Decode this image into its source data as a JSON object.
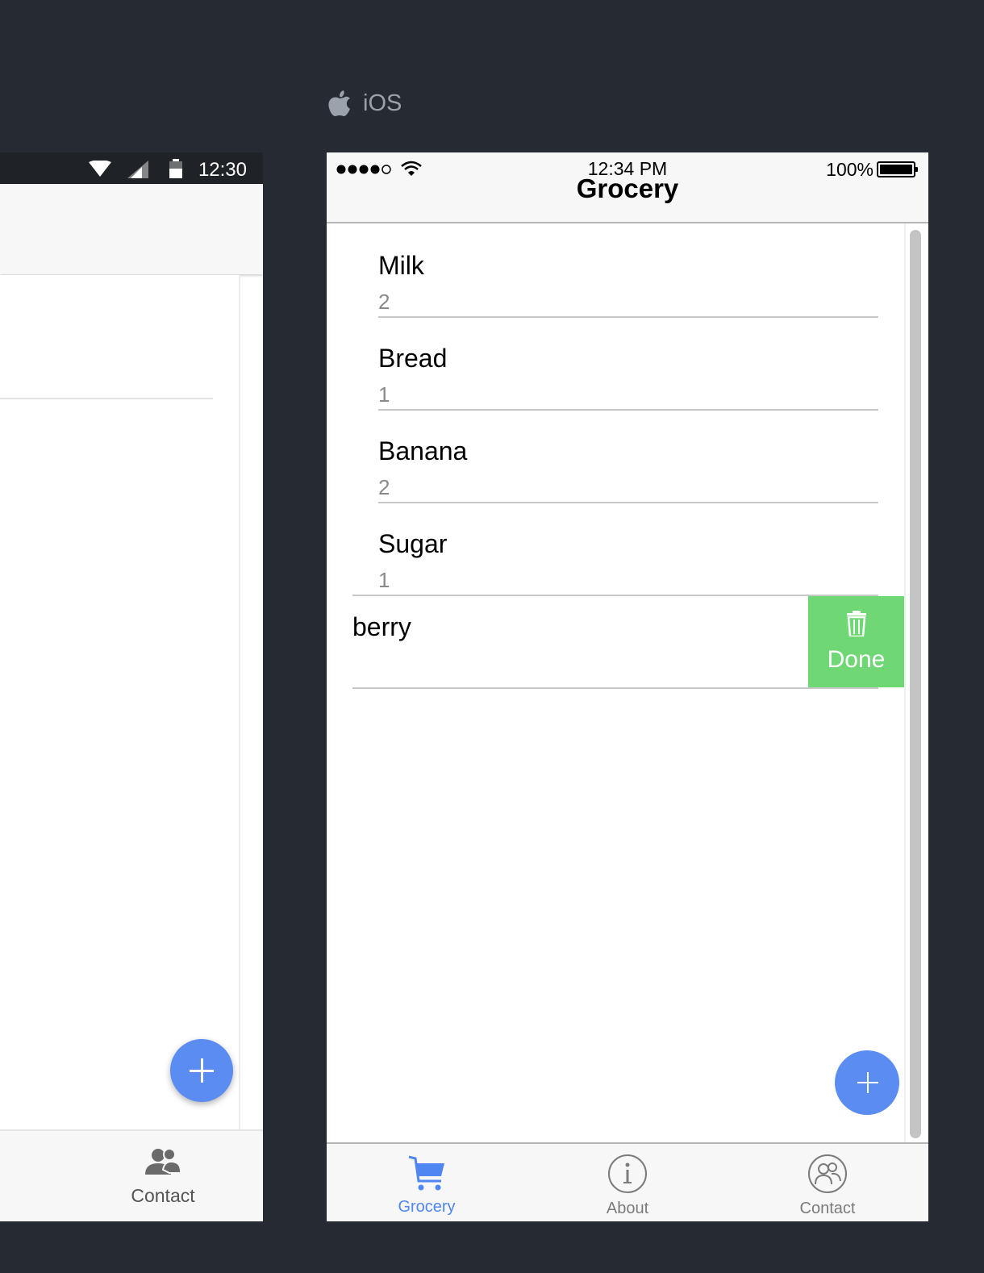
{
  "android": {
    "status_time": "12:30",
    "tabs": [
      {
        "label": "Contact",
        "icon": "contacts-icon"
      }
    ],
    "fab_icon": "plus-icon",
    "accent": "#5a8cf2"
  },
  "platform_label": {
    "text": "iOS",
    "icon": "apple-icon"
  },
  "ios": {
    "status": {
      "signal_icon": "signal-dots-icon",
      "wifi_icon": "wifi-icon",
      "time": "12:34 PM",
      "battery": "100%"
    },
    "title": "Grocery",
    "items": [
      {
        "name": "Milk",
        "qty": "2"
      },
      {
        "name": "Bread",
        "qty": "1"
      },
      {
        "name": "Banana",
        "qty": "2"
      },
      {
        "name": "Sugar",
        "qty": "1"
      }
    ],
    "swiped_item": {
      "name": "berry",
      "action_label": "Done",
      "action_icon": "trash-icon",
      "action_color": "#6fd774"
    },
    "fab_icon": "plus-icon",
    "tabs": [
      {
        "label": "Grocery",
        "icon": "cart-icon",
        "active": true
      },
      {
        "label": "About",
        "icon": "info-icon",
        "active": false
      },
      {
        "label": "Contact",
        "icon": "contacts-icon",
        "active": false
      }
    ],
    "accent": "#4f86f2"
  }
}
